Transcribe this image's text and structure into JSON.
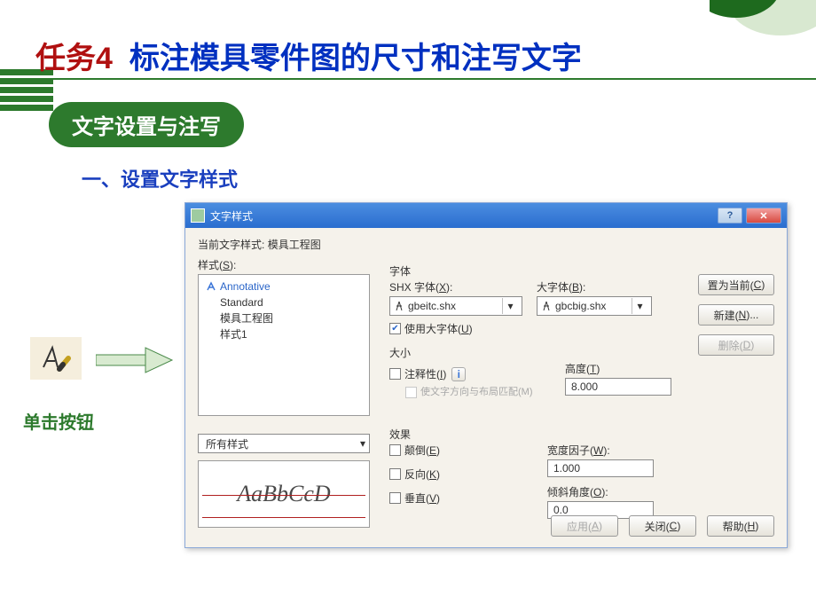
{
  "slide": {
    "task_prefix": "任务4",
    "task_title": "标注模具零件图的尺寸和注写文字",
    "green_tag": "文字设置与注写",
    "section": "一、设置文字样式",
    "icon_label": "单击按钮"
  },
  "dialog": {
    "title": "文字样式",
    "current_style_label": "当前文字样式:",
    "current_style_value": "模具工程图",
    "styles_label": "样式(S):",
    "styles": [
      "Annotative",
      "Standard",
      "模具工程图",
      "样式1"
    ],
    "filter": "所有样式",
    "preview": "AaBbCcD",
    "font": {
      "group_label": "字体",
      "shx_label": "SHX 字体(X):",
      "shx_value": "gbeitc.shx",
      "big_label": "大字体(B):",
      "big_value": "gbcbig.shx",
      "use_big_label": "使用大字体(U)",
      "use_big_checked": true
    },
    "size": {
      "group_label": "大小",
      "annotative_label": "注释性(I)",
      "annotative_checked": false,
      "match_label": "使文字方向与布局匹配(M)",
      "height_label": "高度(T)",
      "height_value": "8.000"
    },
    "effects": {
      "group_label": "效果",
      "upside_label": "颠倒(E)",
      "backward_label": "反向(K)",
      "vertical_label": "垂直(V)",
      "width_label": "宽度因子(W):",
      "width_value": "1.000",
      "oblique_label": "倾斜角度(O):",
      "oblique_value": "0.0"
    },
    "buttons": {
      "set_current": "置为当前(C)",
      "new": "新建(N)...",
      "delete": "删除(D)",
      "apply": "应用(A)",
      "close": "关闭(C)",
      "help": "帮助(H)"
    }
  }
}
